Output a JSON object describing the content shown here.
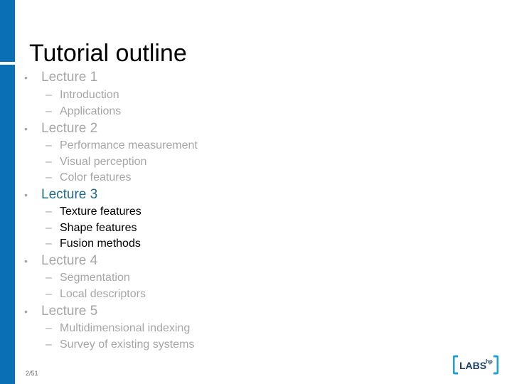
{
  "slide": {
    "title": "Tutorial outline",
    "page_number": "2/51",
    "bullet_glyph": "•",
    "dash_glyph": "–",
    "colors": {
      "side_bar": "#0a6fb5",
      "inactive_text": "#a6a6a6",
      "active_heading": "#1f6b8c",
      "active_subitem": "#000000"
    },
    "outline": [
      {
        "label": "Lecture 1",
        "active": false,
        "items": [
          "Introduction",
          "Applications"
        ]
      },
      {
        "label": "Lecture 2",
        "active": false,
        "items": [
          "Performance measurement",
          "Visual perception",
          "Color features"
        ]
      },
      {
        "label": "Lecture 3",
        "active": true,
        "items": [
          "Texture features",
          "Shape features",
          "Fusion methods"
        ]
      },
      {
        "label": "Lecture 4",
        "active": false,
        "items": [
          "Segmentation",
          "Local descriptors"
        ]
      },
      {
        "label": "Lecture 5",
        "active": false,
        "items": [
          "Multidimensional indexing",
          "Survey of existing systems"
        ]
      }
    ],
    "logo": {
      "text": "LABS",
      "superscript": "hp",
      "icon": "labs-hp-logo"
    }
  }
}
